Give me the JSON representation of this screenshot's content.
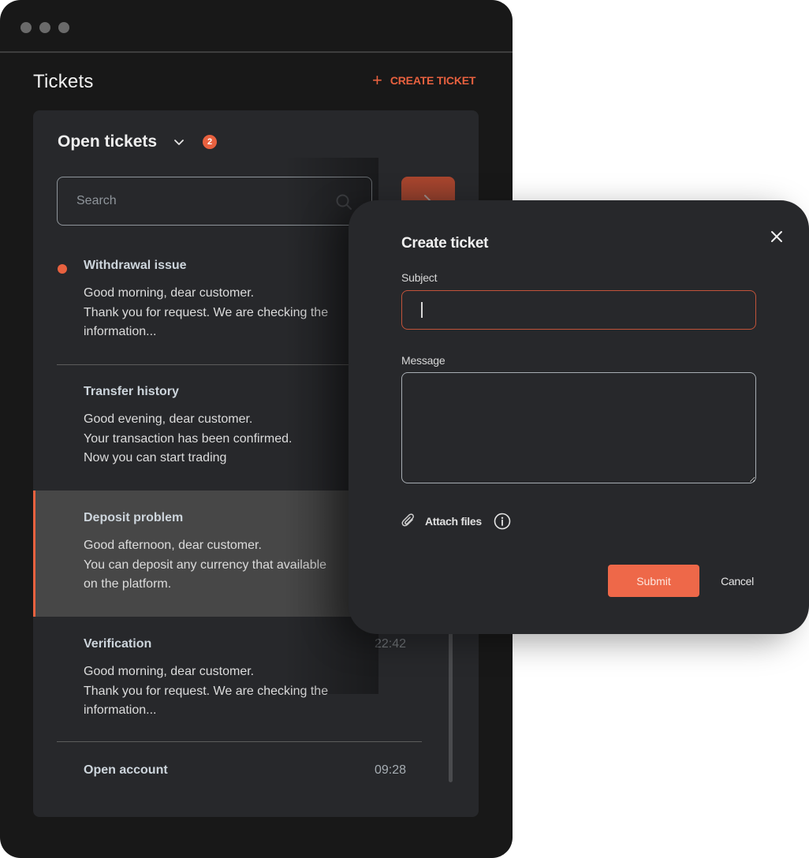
{
  "window": {
    "title": "Tickets",
    "create_button_label": "CREATE TICKET",
    "create_button_icon": "plus-icon"
  },
  "panel": {
    "title": "Open tickets",
    "dropdown_icon": "chevron-down-icon",
    "badge_count": "2",
    "search": {
      "placeholder": "Search",
      "value": "",
      "icon": "search-icon"
    },
    "filter_button_icon": "chevron-right-icon"
  },
  "tickets": [
    {
      "title": "Withdrawal issue",
      "time": "",
      "unread": true,
      "selected": false,
      "body": "Good morning, dear customer.\nThank you for request. We are checking the\ninformation..."
    },
    {
      "title": "Transfer history",
      "time": "",
      "unread": false,
      "selected": false,
      "body": "Good evening, dear customer.\nYour transaction has been confirmed.\nNow you can start trading"
    },
    {
      "title": "Deposit problem",
      "time": "",
      "unread": false,
      "selected": true,
      "body": "Good afternoon, dear customer.\nYou can deposit any currency that available\non the platform."
    },
    {
      "title": "Verification",
      "time": "22:42",
      "unread": false,
      "selected": false,
      "body": "Good morning, dear customer.\nThank you for request. We are checking the\ninformation..."
    },
    {
      "title": "Open account",
      "time": "09:28",
      "unread": false,
      "selected": false,
      "body": ""
    }
  ],
  "modal": {
    "title": "Create ticket",
    "close_icon": "close-icon",
    "subject_label": "Subject",
    "subject_value": "",
    "message_label": "Message",
    "message_value": "",
    "attach_label": "Attach files",
    "attach_icon": "paperclip-icon",
    "info_icon": "info-icon",
    "submit_label": "Submit",
    "cancel_label": "Cancel"
  },
  "colors": {
    "accent": "#e8613f",
    "window_bg": "#181818",
    "panel_bg": "#27282b",
    "selected_bg": "#474747",
    "submit_bg": "#ee6849"
  }
}
